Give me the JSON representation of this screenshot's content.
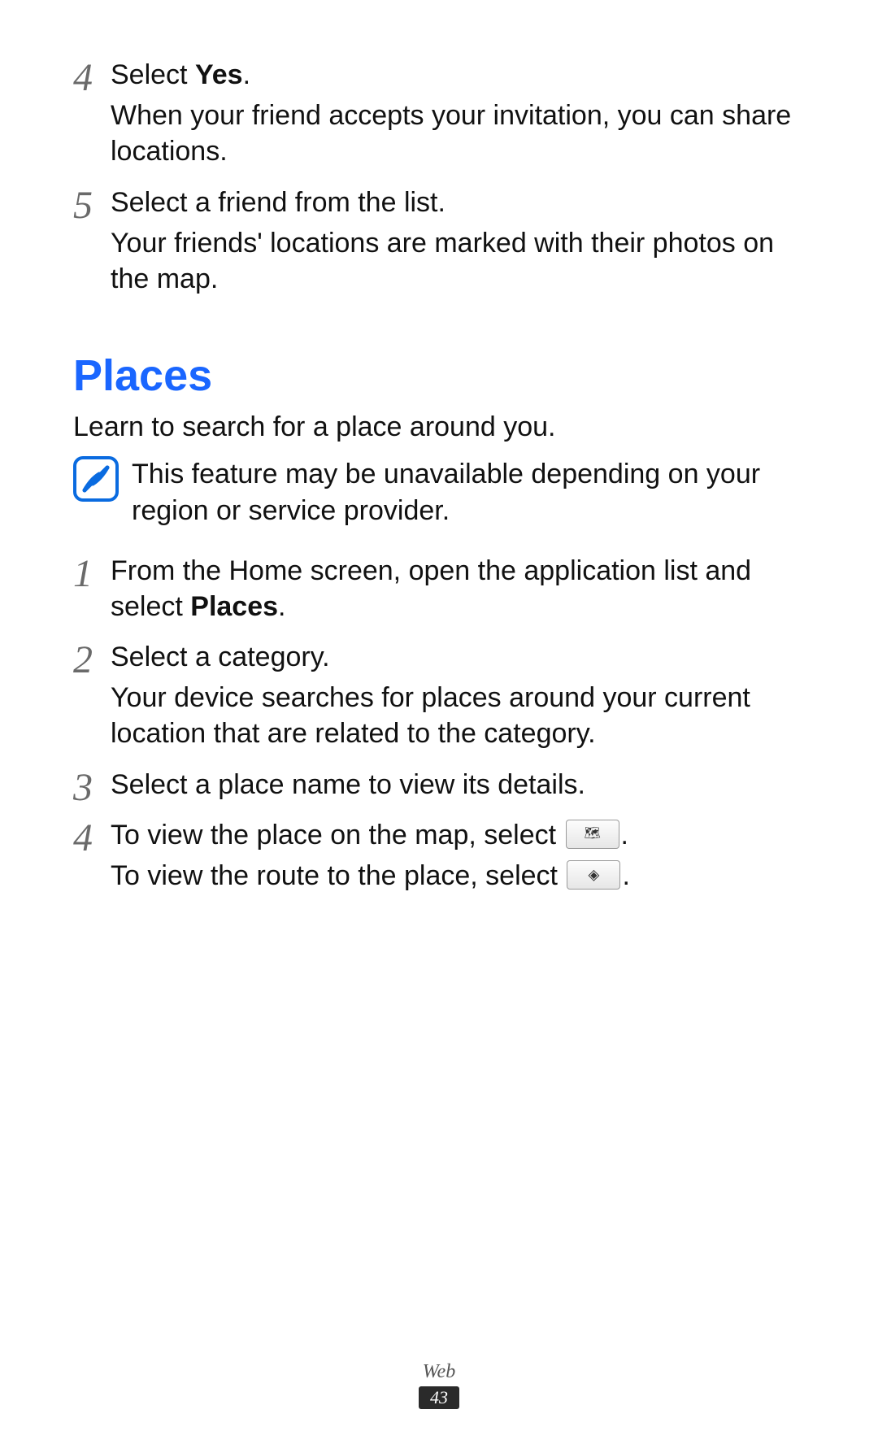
{
  "steps_top": [
    {
      "number": "4",
      "lines": [
        {
          "parts": [
            {
              "text": "Select "
            },
            {
              "text": "Yes",
              "bold": true
            },
            {
              "text": "."
            }
          ]
        },
        {
          "parts": [
            {
              "text": "When your friend accepts your invitation, you can share locations."
            }
          ]
        }
      ]
    },
    {
      "number": "5",
      "lines": [
        {
          "parts": [
            {
              "text": "Select a friend from the list."
            }
          ]
        },
        {
          "parts": [
            {
              "text": "Your friends' locations are marked with their photos on the map."
            }
          ]
        }
      ]
    }
  ],
  "heading": "Places",
  "intro": "Learn to search for a place around you.",
  "note": "This feature may be unavailable depending on your region or service provider.",
  "steps_bottom": [
    {
      "number": "1",
      "lines": [
        {
          "parts": [
            {
              "text": "From the Home screen, open the application list and select "
            },
            {
              "text": "Places",
              "bold": true
            },
            {
              "text": "."
            }
          ]
        }
      ]
    },
    {
      "number": "2",
      "lines": [
        {
          "parts": [
            {
              "text": "Select a category."
            }
          ]
        },
        {
          "parts": [
            {
              "text": "Your device searches for places around your current location that are related to the category."
            }
          ]
        }
      ]
    },
    {
      "number": "3",
      "lines": [
        {
          "parts": [
            {
              "text": "Select a place name to view its details."
            }
          ]
        }
      ]
    },
    {
      "number": "4",
      "lines": [
        {
          "parts": [
            {
              "text": "To view the place on the map, select "
            },
            {
              "button": "map-icon"
            },
            {
              "text": "."
            }
          ]
        },
        {
          "parts": [
            {
              "text": "To view the route to the place, select "
            },
            {
              "button": "route-icon"
            },
            {
              "text": "."
            }
          ]
        }
      ]
    }
  ],
  "footer": {
    "section": "Web",
    "page": "43"
  }
}
